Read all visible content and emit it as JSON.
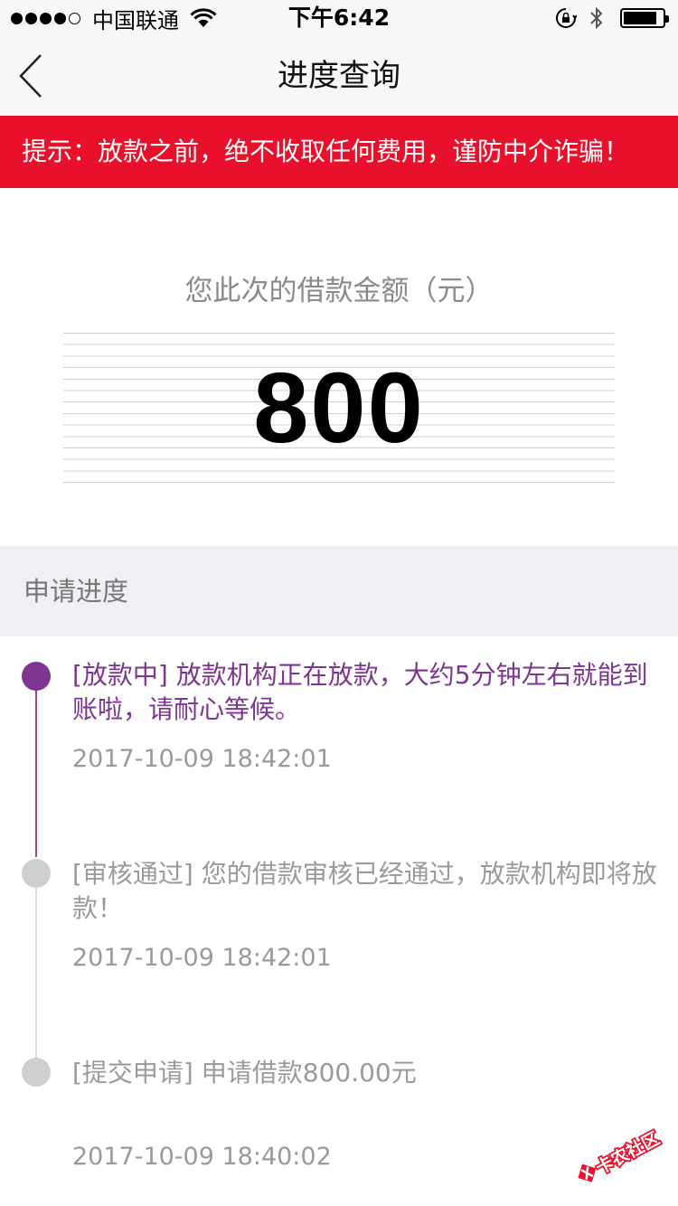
{
  "status_bar": {
    "carrier": "中国联通",
    "time": "下午6:42",
    "battery_level": 0.85
  },
  "nav": {
    "title": "进度查询"
  },
  "banner": {
    "text": "提示：放款之前，绝不收取任何费用，谨防中介诈骗！"
  },
  "amount": {
    "label": "您此次的借款金额（元）",
    "value": "800"
  },
  "progress": {
    "section_title": "申请进度",
    "steps": [
      {
        "text": "[放款中] 放款机构正在放款，大约5分钟左右就能到账啦，请耐心等候。",
        "time": "2017-10-09 18:42:01"
      },
      {
        "text": "[审核通过] 您的借款审核已经通过，放款机构即将放款！",
        "time": "2017-10-09 18:42:01"
      },
      {
        "text": "[提交申请] 申请借款800.00元",
        "time": "2017-10-09 18:40:02"
      }
    ]
  },
  "watermark": {
    "text": "卡农社区"
  },
  "colors": {
    "banner_red": "#e8102a",
    "active_purple": "#7d3590",
    "inactive_gray": "#cfcfcf"
  }
}
